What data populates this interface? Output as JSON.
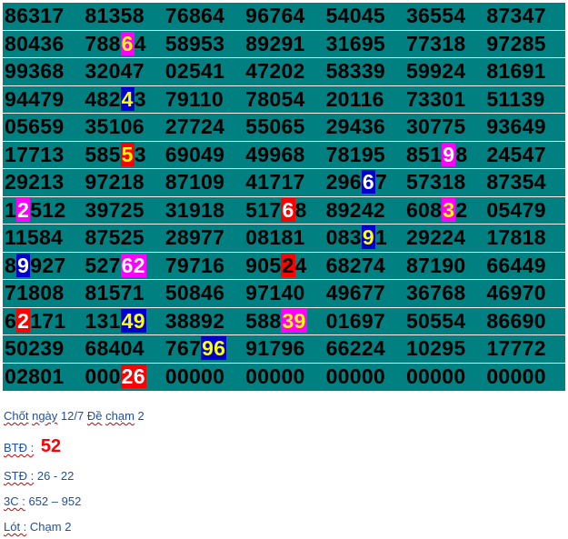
{
  "rows": [
    {
      "cells": [
        {
          "t": "86317"
        },
        {
          "t": "81358"
        },
        {
          "t": "76864"
        },
        {
          "t": "96764"
        },
        {
          "t": "54045"
        },
        {
          "t": "36554"
        },
        {
          "t": "87347"
        }
      ]
    },
    {
      "cells": [
        {
          "t": "80436"
        },
        {
          "p": "788",
          "h": "6",
          "s": "4",
          "c": "magenta"
        },
        {
          "t": "58953"
        },
        {
          "t": "89291"
        },
        {
          "t": "31695"
        },
        {
          "t": "77318"
        },
        {
          "t": "97285"
        }
      ]
    },
    {
      "cells": [
        {
          "t": "99368"
        },
        {
          "t": "32047"
        },
        {
          "t": "02541"
        },
        {
          "t": "47202"
        },
        {
          "t": "58339"
        },
        {
          "t": "59924"
        },
        {
          "t": "81691"
        }
      ]
    },
    {
      "cells": [
        {
          "t": "94479"
        },
        {
          "p": "482",
          "h": "4",
          "s": "3",
          "c": "blue"
        },
        {
          "t": "79110"
        },
        {
          "t": "78054"
        },
        {
          "t": "20116"
        },
        {
          "t": "73301"
        },
        {
          "t": "51139"
        }
      ]
    },
    {
      "cells": [
        {
          "t": "05659"
        },
        {
          "t": "35106"
        },
        {
          "t": "27724"
        },
        {
          "t": "55065"
        },
        {
          "t": "29436"
        },
        {
          "t": "30775"
        },
        {
          "t": "93649"
        }
      ]
    },
    {
      "cells": [
        {
          "t": "17713"
        },
        {
          "p": "585",
          "h": "5",
          "s": "3",
          "c": "red"
        },
        {
          "t": "69049"
        },
        {
          "t": "49968"
        },
        {
          "t": "78195"
        },
        {
          "p": "851",
          "h": "9",
          "s": "8",
          "c": "magenta-w"
        },
        {
          "t": "24547"
        }
      ]
    },
    {
      "cells": [
        {
          "t": "29213"
        },
        {
          "t": "97218"
        },
        {
          "t": "87109"
        },
        {
          "t": "41717"
        },
        {
          "p": "296",
          "h": "6",
          "s": "7",
          "c": "blue-w"
        },
        {
          "t": "57318"
        },
        {
          "t": "87354"
        }
      ]
    },
    {
      "cells": [
        {
          "p": "1",
          "h": "2",
          "s": "512",
          "c": "magenta-w"
        },
        {
          "t": "39725"
        },
        {
          "t": "31918"
        },
        {
          "p": "517",
          "h": "6",
          "s": "8",
          "c": "red-w"
        },
        {
          "t": "89242"
        },
        {
          "p": "608",
          "h": "3",
          "s": "2",
          "c": "magenta"
        },
        {
          "t": "05479"
        }
      ]
    },
    {
      "cells": [
        {
          "t": "11584"
        },
        {
          "t": "87525"
        },
        {
          "t": "28977"
        },
        {
          "t": "08181"
        },
        {
          "p": "083",
          "h": "9",
          "s": "1",
          "c": "blue"
        },
        {
          "t": "29224"
        },
        {
          "t": "17818"
        }
      ]
    },
    {
      "cells": [
        {
          "p": "8",
          "h": "9",
          "s": "927",
          "c": "blue-w"
        },
        {
          "p": "527",
          "h": "62",
          "s": "",
          "c": "magenta-w"
        },
        {
          "t": "79716"
        },
        {
          "p": "905",
          "h": "2",
          "s": "4",
          "c": "red-b"
        },
        {
          "t": "68274"
        },
        {
          "t": "87190"
        },
        {
          "t": "66449"
        }
      ]
    },
    {
      "cells": [
        {
          "t": "71808"
        },
        {
          "t": "81571"
        },
        {
          "t": "50846"
        },
        {
          "t": "97140"
        },
        {
          "t": "49677"
        },
        {
          "t": "36768"
        },
        {
          "t": "46970"
        }
      ]
    },
    {
      "cells": [
        {
          "p": "6",
          "h": "2",
          "s": "171",
          "c": "red-w"
        },
        {
          "p": "131",
          "h": "49",
          "s": "",
          "c": "blue"
        },
        {
          "t": "38892"
        },
        {
          "p": "588",
          "h": "39",
          "s": "",
          "c": "magenta"
        },
        {
          "t": "01697"
        },
        {
          "t": "50554"
        },
        {
          "t": "86690"
        }
      ]
    },
    {
      "cells": [
        {
          "t": "50239"
        },
        {
          "t": "68404"
        },
        {
          "p": "767",
          "h": "96",
          "s": "",
          "c": "blue"
        },
        {
          "t": "91796"
        },
        {
          "t": "66224"
        },
        {
          "t": "10295"
        },
        {
          "t": "17772"
        }
      ]
    },
    {
      "cells": [
        {
          "t": "02801"
        },
        {
          "p": "000",
          "h": "26",
          "s": "",
          "c": "red-w"
        },
        {
          "t": "00000"
        },
        {
          "t": "00000"
        },
        {
          "t": "00000"
        },
        {
          "t": "00000"
        },
        {
          "t": "00000"
        }
      ]
    }
  ],
  "notes": {
    "line1_a": "Chốt",
    "line1_b": "ngày",
    "line1_c": "12/7",
    "line1_d": "Đề",
    "line1_e": "chạm",
    "line1_f": "2",
    "btd_label": "BTĐ :",
    "btd_value": "52",
    "std_label": "STĐ :",
    "std_value": "26 - 22",
    "c3_label": "3C :",
    "c3_value": "652  – 952",
    "lot_label": "Lót :",
    "lot_value": "Chạm 2"
  },
  "colors": {
    "row_bg": "#008080",
    "highlight_magenta": "#ff00ff",
    "highlight_blue": "#0000cc",
    "highlight_red": "#ff0000",
    "highlight_text_yellow": "#ffff00",
    "note_text": "#1f4fa8",
    "btd_value": "#ff0000"
  }
}
